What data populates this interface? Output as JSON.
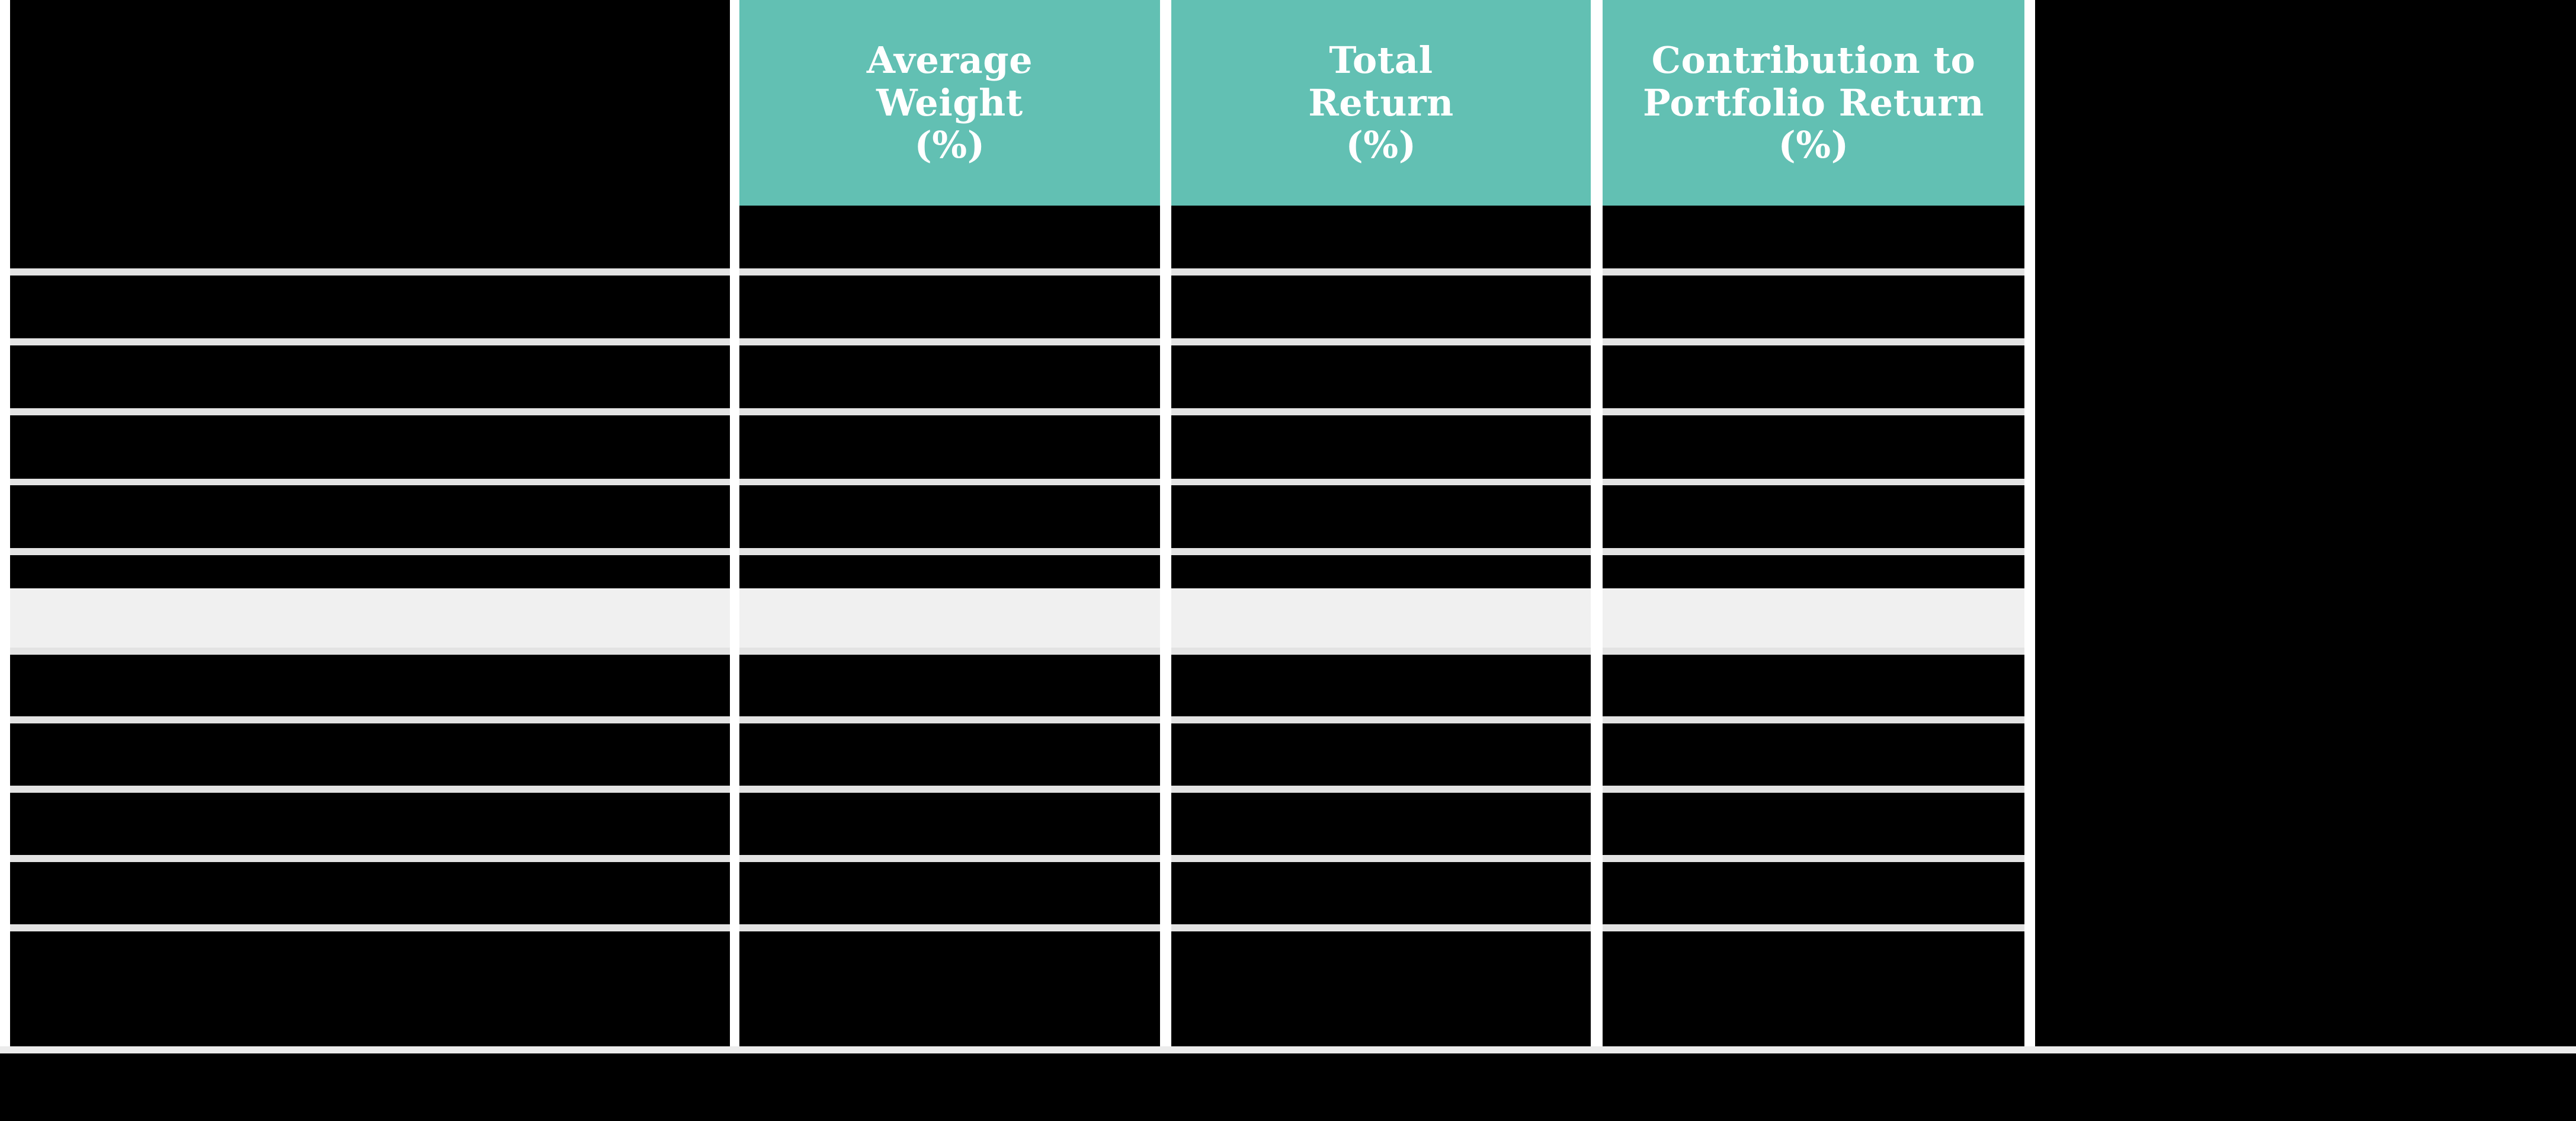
{
  "table": {
    "accent_color": "#62c0b3",
    "header_text_color": "#ffffff",
    "cell_background": "#000000",
    "highlight_row_color": "#f0f0f0",
    "gridline_color": "#e3e3e3",
    "columns": [
      {
        "id": "label",
        "lines": [
          "",
          "",
          ""
        ],
        "header_filled": false
      },
      {
        "id": "average_weight",
        "lines": [
          "Average",
          "Weight",
          "(%)"
        ],
        "header_filled": true
      },
      {
        "id": "total_return",
        "lines": [
          "Total",
          "Return",
          "(%)"
        ],
        "header_filled": true
      },
      {
        "id": "contribution",
        "lines": [
          "Contribution to",
          "Portfolio Return",
          "(%)"
        ],
        "header_filled": true
      }
    ],
    "rows": [
      {
        "index": 0,
        "highlighted": false,
        "cells": [
          "",
          "",
          "",
          ""
        ]
      },
      {
        "index": 1,
        "highlighted": false,
        "cells": [
          "",
          "",
          "",
          ""
        ]
      },
      {
        "index": 2,
        "highlighted": false,
        "cells": [
          "",
          "",
          "",
          ""
        ]
      },
      {
        "index": 3,
        "highlighted": false,
        "cells": [
          "",
          "",
          "",
          ""
        ]
      },
      {
        "index": 4,
        "highlighted": false,
        "cells": [
          "",
          "",
          "",
          ""
        ]
      },
      {
        "index": 5,
        "highlighted": true,
        "cells": [
          "",
          "",
          "",
          ""
        ]
      },
      {
        "index": 6,
        "highlighted": false,
        "cells": [
          "",
          "",
          "",
          ""
        ]
      },
      {
        "index": 7,
        "highlighted": false,
        "cells": [
          "",
          "",
          "",
          ""
        ]
      },
      {
        "index": 8,
        "highlighted": false,
        "cells": [
          "",
          "",
          "",
          ""
        ]
      },
      {
        "index": 9,
        "highlighted": false,
        "cells": [
          "",
          "",
          "",
          ""
        ]
      },
      {
        "index": 10,
        "highlighted": false,
        "cells": [
          "",
          "",
          "",
          ""
        ]
      },
      {
        "index": 11,
        "highlighted": false,
        "cells": [
          "",
          "",
          "",
          ""
        ]
      }
    ]
  }
}
